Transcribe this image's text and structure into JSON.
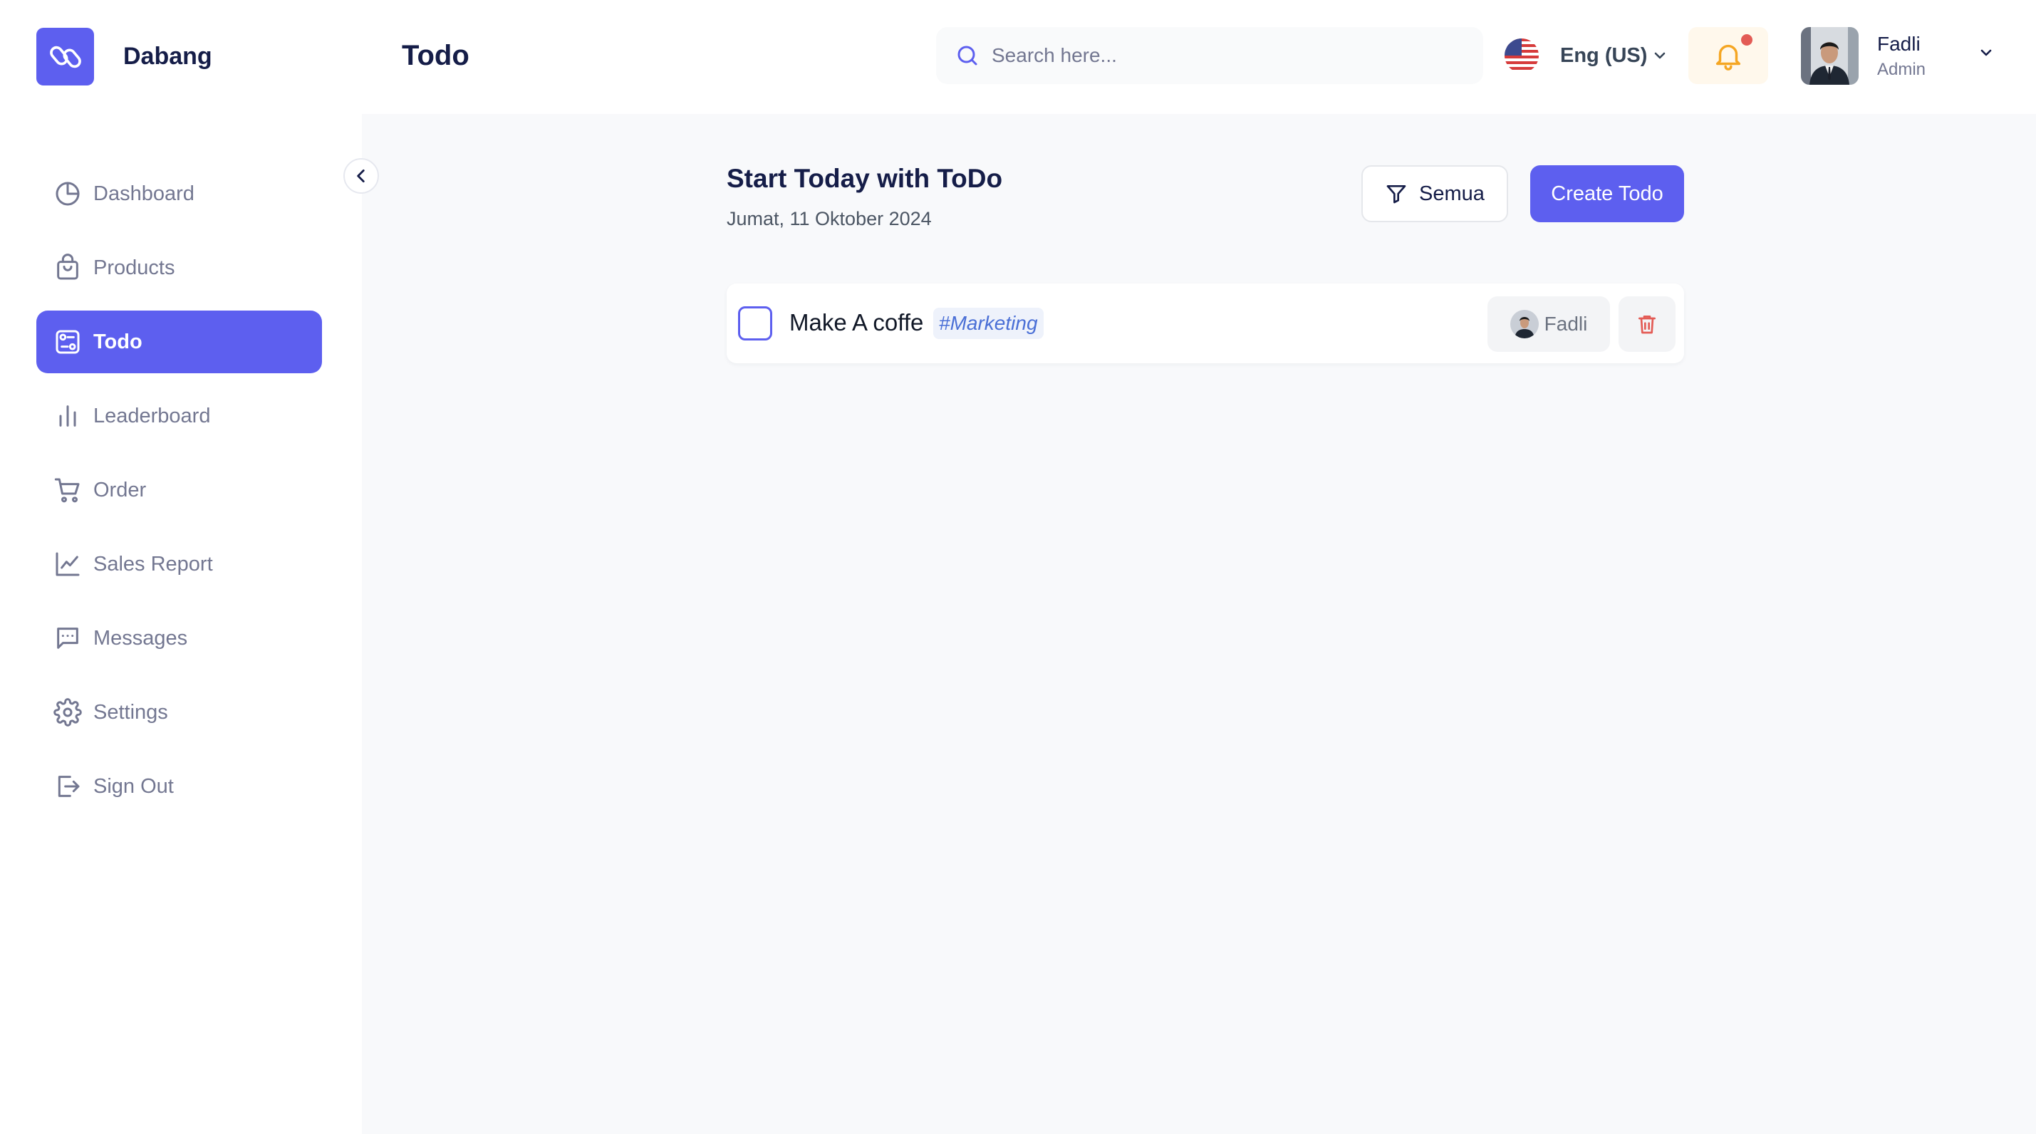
{
  "brand": {
    "name": "Dabang",
    "logo_icon": "tag-icon"
  },
  "header": {
    "title": "Todo",
    "search": {
      "placeholder": "Search here...",
      "value": ""
    },
    "language": {
      "label": "Eng (US)",
      "flag": "us-flag-icon"
    },
    "notifications": {
      "has_unread": true
    },
    "user": {
      "name": "Fadli",
      "role": "Admin"
    }
  },
  "sidebar": {
    "items": [
      {
        "label": "Dashboard",
        "icon": "pie-chart-icon",
        "active": false
      },
      {
        "label": "Products",
        "icon": "shopping-bag-icon",
        "active": false
      },
      {
        "label": "Todo",
        "icon": "todo-icon",
        "active": true
      },
      {
        "label": "Leaderboard",
        "icon": "bar-chart-icon",
        "active": false
      },
      {
        "label": "Order",
        "icon": "cart-icon",
        "active": false
      },
      {
        "label": "Sales Report",
        "icon": "line-chart-icon",
        "active": false
      },
      {
        "label": "Messages",
        "icon": "message-icon",
        "active": false
      },
      {
        "label": "Settings",
        "icon": "gear-icon",
        "active": false
      },
      {
        "label": "Sign Out",
        "icon": "sign-out-icon",
        "active": false
      }
    ]
  },
  "main": {
    "heading": "Start Today with ToDo",
    "date": "Jumat, 11 Oktober 2024",
    "filter_label": "Semua",
    "create_label": "Create Todo",
    "todos": [
      {
        "title": "Make A coffe",
        "tag": "#Marketing",
        "assignee": "Fadli",
        "done": false
      }
    ]
  },
  "colors": {
    "accent": "#5d5fef",
    "text_primary": "#151d48",
    "text_muted": "#737791",
    "danger": "#e35b55",
    "warning": "#f5a623",
    "main_bg": "#f8f9fb"
  }
}
